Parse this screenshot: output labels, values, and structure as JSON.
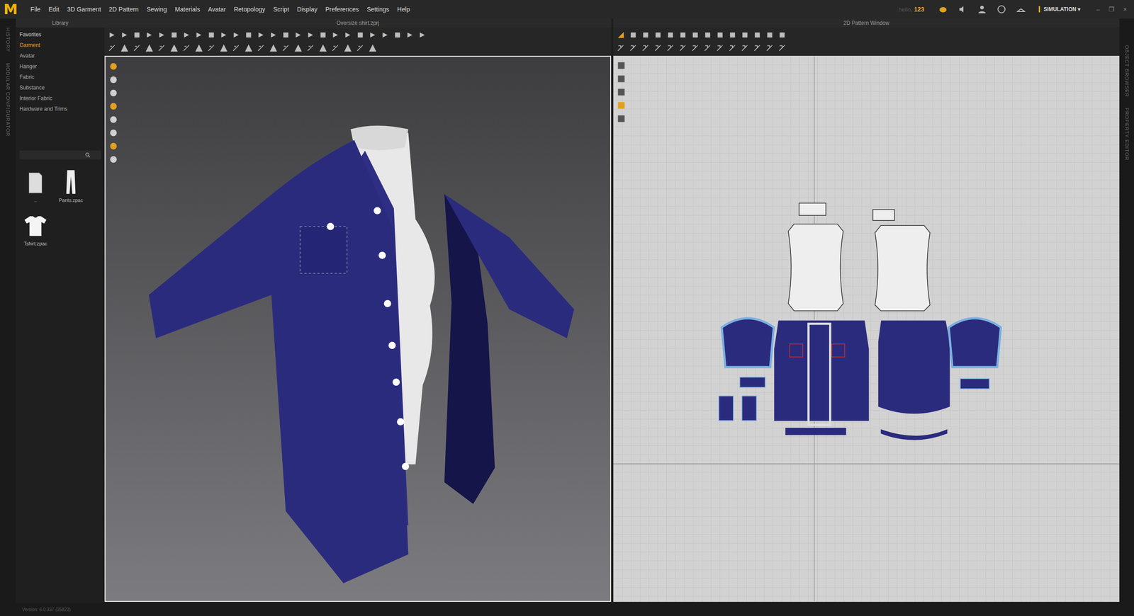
{
  "app": {
    "logo": "M",
    "menu": [
      "File",
      "Edit",
      "3D Garment",
      "2D Pattern",
      "Sewing",
      "Materials",
      "Avatar",
      "Retopology",
      "Script",
      "Display",
      "Preferences",
      "Settings",
      "Help"
    ],
    "user_label": "hello,",
    "user_id": "123",
    "mode": "SIMULATION",
    "mode_caret": "▾",
    "window_controls": [
      "–",
      "❐",
      "×"
    ]
  },
  "side_tabs_left": [
    "HISTORY",
    "MODULAR CONFIGURATOR"
  ],
  "side_tabs_right": [
    "OBJECT BROWSER",
    "PROPERTY EDITOR"
  ],
  "library": {
    "title": "Library",
    "categories": [
      {
        "label": "Favorites",
        "selected": false
      },
      {
        "label": "Garment",
        "selected": true
      },
      {
        "label": "Avatar",
        "selected": false
      },
      {
        "label": "Hanger",
        "selected": false
      },
      {
        "label": "Fabric",
        "selected": false
      },
      {
        "label": "Substance",
        "selected": false
      },
      {
        "label": "Interior Fabric",
        "selected": false
      },
      {
        "label": "Hardware and Trims",
        "selected": false
      }
    ],
    "files": [
      {
        "name": "..",
        "kind": "folder"
      },
      {
        "name": "Pants.zpac",
        "kind": "pants"
      },
      {
        "name": "Tshirt.zpac",
        "kind": "tshirt"
      }
    ]
  },
  "viewport": {
    "title": "Oversize shirt.zprj"
  },
  "pattern_window": {
    "title": "2D Pattern Window"
  },
  "status_bar": {
    "version": "Version: 6.0.337 (35823)"
  }
}
